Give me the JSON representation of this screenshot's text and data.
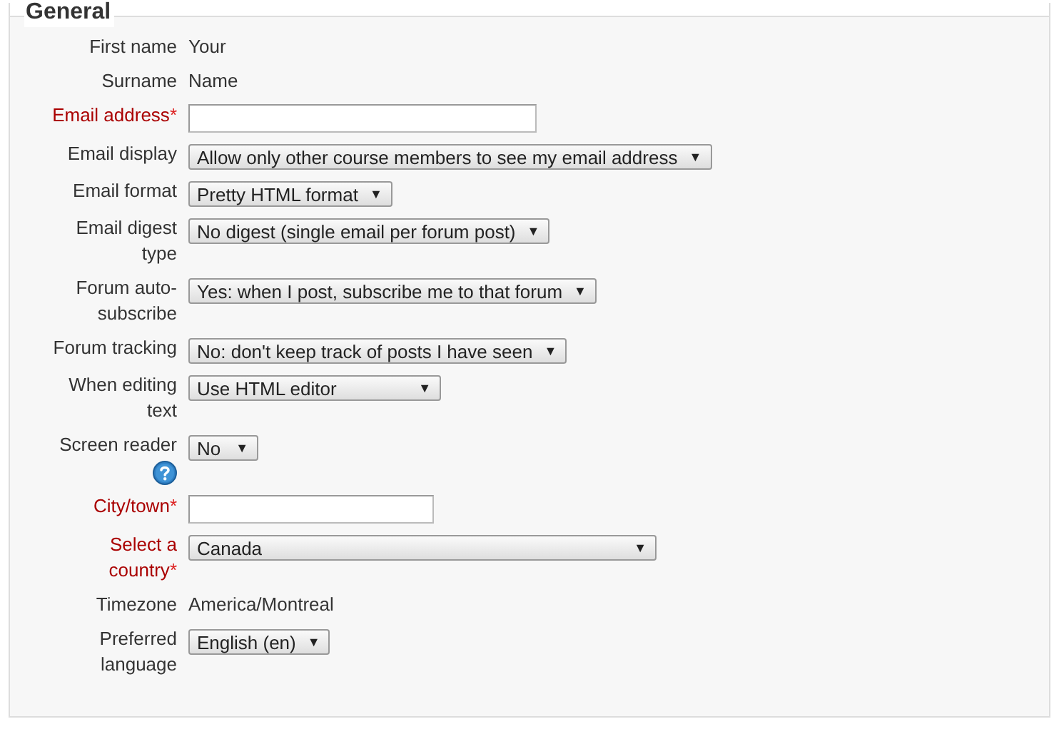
{
  "section": {
    "title": "General"
  },
  "rows": [
    {
      "kind": "static",
      "label": "First name",
      "required": false,
      "value": "Your"
    },
    {
      "kind": "static",
      "label": "Surname",
      "required": false,
      "value": "Name"
    },
    {
      "kind": "text",
      "label": "Email address",
      "required": true,
      "asterisk": "*"
    },
    {
      "kind": "select",
      "label": "Email display",
      "required": false,
      "value": "Allow only other course members to see my email address",
      "arrow": "▼"
    },
    {
      "kind": "select",
      "label": "Email format",
      "required": false,
      "value": "Pretty HTML format",
      "arrow": "▼"
    },
    {
      "kind": "select",
      "label": "Email digest type",
      "required": false,
      "value": "No digest (single email per forum post)",
      "arrow": "▼"
    },
    {
      "kind": "select",
      "label": "Forum auto-subscribe",
      "required": false,
      "value": "Yes: when I post, subscribe me to that forum",
      "arrow": "▼"
    },
    {
      "kind": "select",
      "label": "Forum tracking",
      "required": false,
      "value": "No: don't keep track of posts I have seen",
      "arrow": "▼"
    },
    {
      "kind": "select",
      "label": "When editing text",
      "required": false,
      "value": "Use HTML editor",
      "arrow": "▼"
    },
    {
      "kind": "select",
      "label": "Screen reader",
      "required": false,
      "help": true,
      "value": "No",
      "arrow": "▼"
    },
    {
      "kind": "text",
      "label": "City/town",
      "required": true,
      "asterisk": "*"
    },
    {
      "kind": "select",
      "label": "Select a country",
      "required": true,
      "asterisk": "*",
      "value": "Canada",
      "arrow": "▼"
    },
    {
      "kind": "static",
      "label": "Timezone",
      "required": false,
      "value": "America/Montreal"
    },
    {
      "kind": "select",
      "label": "Preferred language",
      "required": false,
      "value": "English (en)",
      "arrow": "▼"
    }
  ]
}
